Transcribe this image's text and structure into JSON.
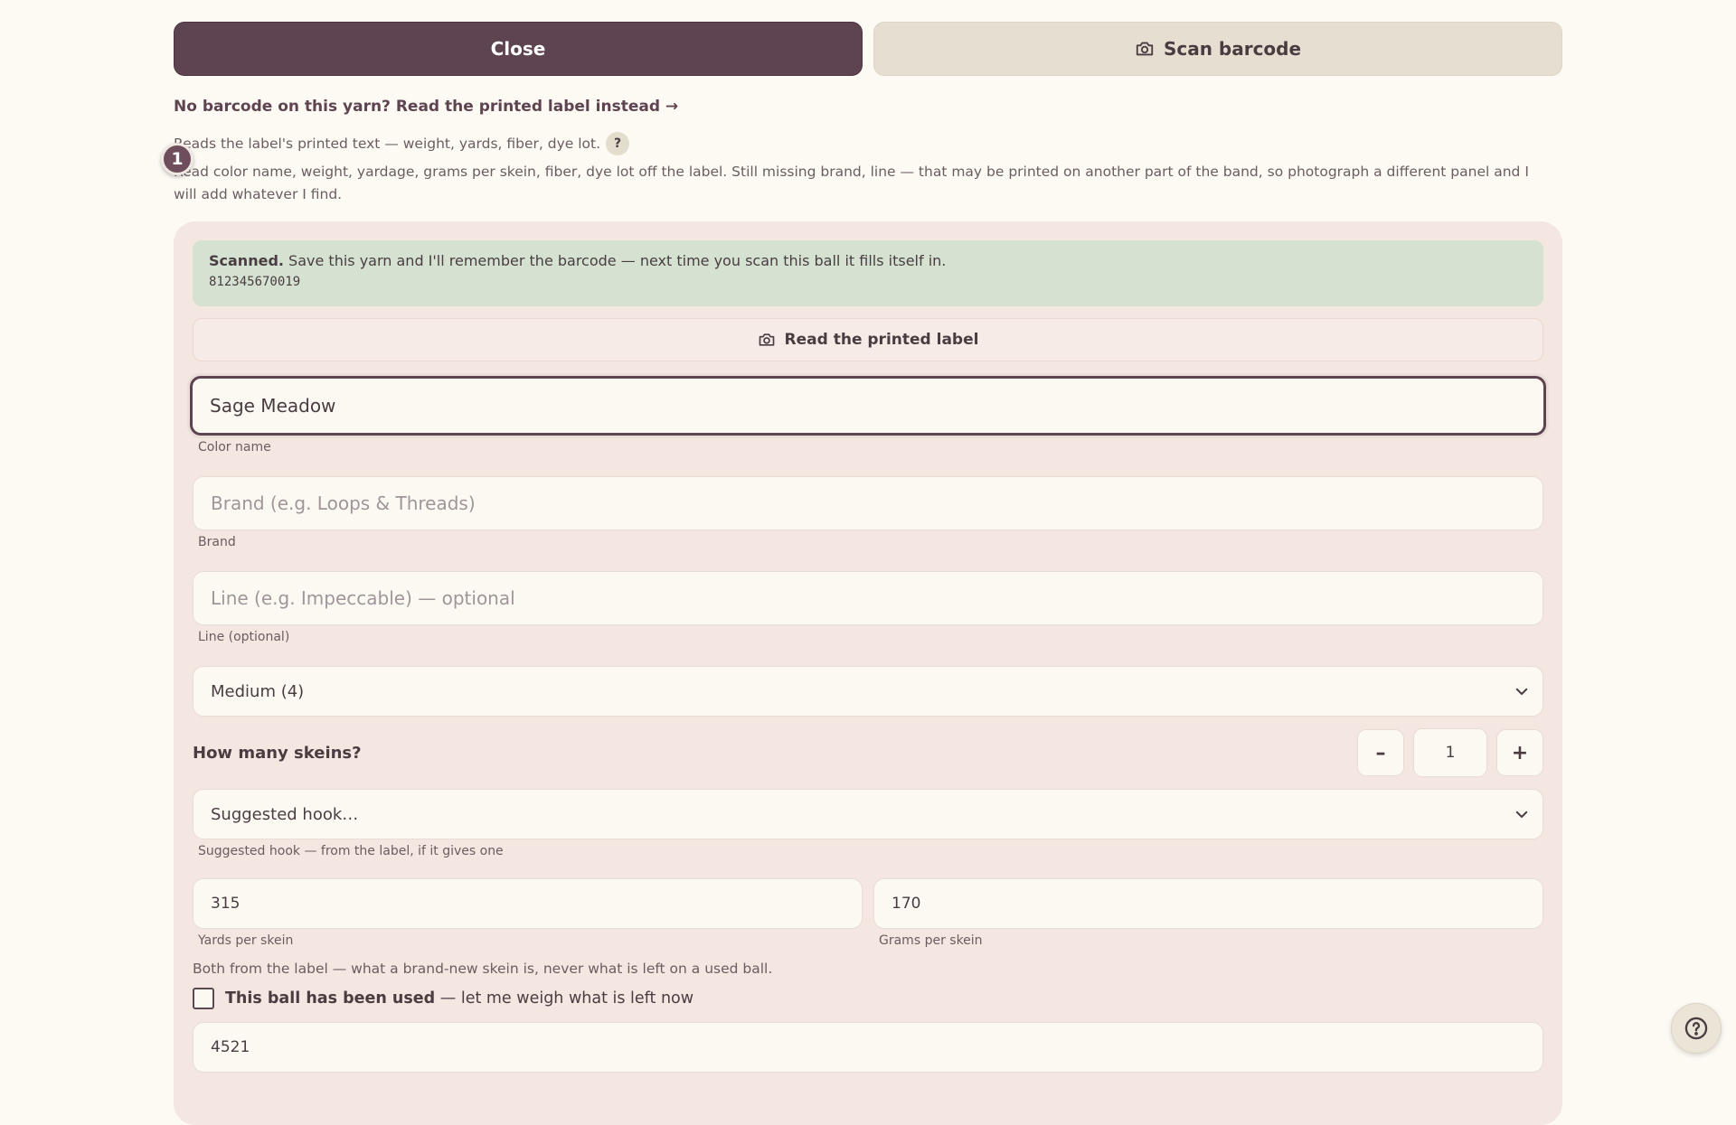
{
  "topbar": {
    "close_label": "Close",
    "scan_label": "Scan barcode"
  },
  "no_barcode_link": "No barcode on this yarn? Read the printed label instead →",
  "reads_text": "Reads the label's printed text — weight, yards, fiber, dye lot.",
  "help_badge": "?",
  "step_badge": "1",
  "readout_text": "Read color name, weight, yardage, grams per skein, fiber, dye lot off the label. Still missing brand, line — that may be printed on another part of the band, so photograph a different panel and I will add whatever I find.",
  "scanned": {
    "strong": "Scanned.",
    "message": " Save this yarn and I'll remember the barcode — next time you scan this ball it fills itself in.",
    "barcode": "812345670019"
  },
  "read_label_button": "Read the printed label",
  "color_name": {
    "value": "Sage Meadow",
    "label": "Color name"
  },
  "brand": {
    "placeholder": "Brand (e.g. Loops & Threads)",
    "label": "Brand"
  },
  "line": {
    "placeholder": "Line (e.g. Impeccable) — optional",
    "label": "Line (optional)"
  },
  "weight_select": {
    "value": "Medium (4)"
  },
  "skeins": {
    "label": "How many skeins?",
    "minus": "–",
    "value": "1",
    "plus": "+"
  },
  "hook_select": {
    "value": "Suggested hook…",
    "label": "Suggested hook — from the label, if it gives one"
  },
  "yards": {
    "value": "315",
    "label": "Yards per skein"
  },
  "grams": {
    "value": "170",
    "label": "Grams per skein"
  },
  "both_note": "Both from the label — what a brand-new skein is, never what is left on a used ball.",
  "used": {
    "strong": "This ball has been used",
    "rest": " — let me weigh what is left now",
    "checked": false
  },
  "dye_lot": {
    "value": "4521"
  },
  "colors": {
    "accent": "#5e4350",
    "panel": "#f4e6e0",
    "success": "#d5e2d1",
    "page": "#fdfaf4"
  },
  "icons": {
    "scan": "camera-icon",
    "read_label": "camera-icon",
    "help": "help-circle-icon",
    "select": "chevron-down-icon"
  }
}
